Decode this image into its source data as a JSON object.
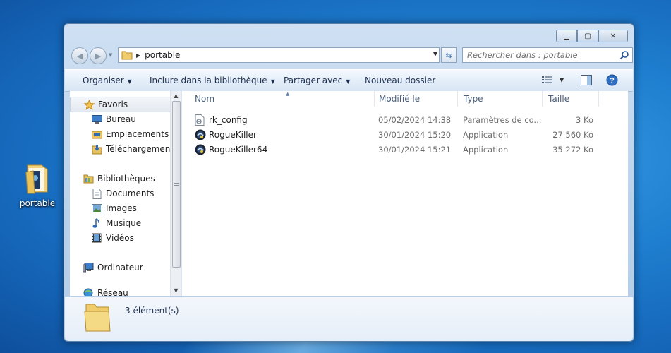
{
  "desktop": {
    "icon_label": "portable"
  },
  "window": {
    "address": {
      "crumb": "portable"
    },
    "search": {
      "placeholder": "Rechercher dans : portable"
    },
    "toolbar": {
      "organize": "Organiser",
      "include_library": "Inclure dans la bibliothèque",
      "share": "Partager avec",
      "new_folder": "Nouveau dossier"
    },
    "nav_pane": {
      "favorites": "Favoris",
      "desktop": "Bureau",
      "recent_places": "Emplacements récents",
      "downloads": "Téléchargements",
      "libraries": "Bibliothèques",
      "documents": "Documents",
      "pictures": "Images",
      "music": "Musique",
      "videos": "Vidéos",
      "computer": "Ordinateur",
      "network": "Réseau"
    },
    "columns": {
      "name": "Nom",
      "modified": "Modifié le",
      "type": "Type",
      "size": "Taille"
    },
    "files": [
      {
        "name": "rk_config",
        "modified": "05/02/2024 14:38",
        "type": "Paramètres de co...",
        "size": "3 Ko",
        "icon": "config-file-icon"
      },
      {
        "name": "RogueKiller",
        "modified": "30/01/2024 15:20",
        "type": "Application",
        "size": "27 560 Ko",
        "icon": "roguekiller-app-icon"
      },
      {
        "name": "RogueKiller64",
        "modified": "30/01/2024 15:21",
        "type": "Application",
        "size": "35 272 Ko",
        "icon": "roguekiller-app-icon"
      }
    ],
    "details": {
      "count": "3 élément(s)"
    }
  }
}
